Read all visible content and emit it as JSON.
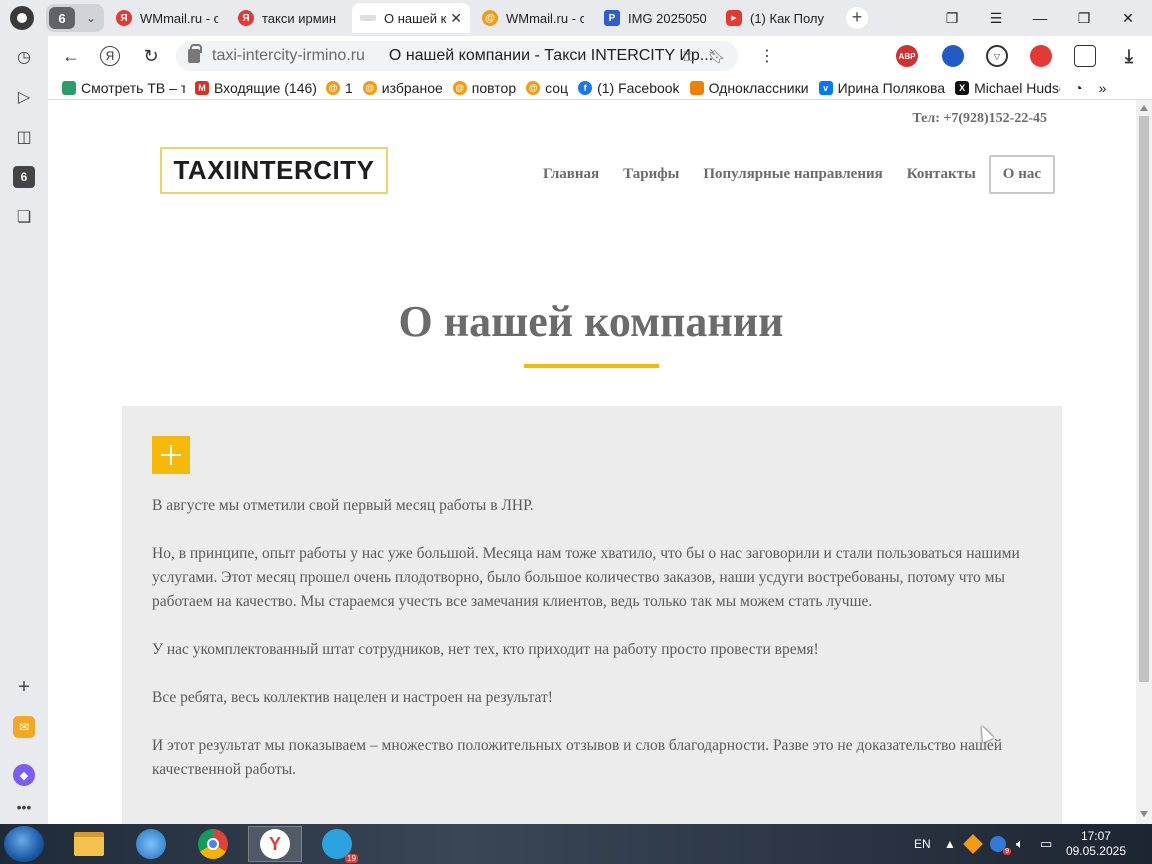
{
  "browser": {
    "tab_group_count": "6",
    "tabs": [
      {
        "title": "WMmail.ru - с",
        "favicon": "yandex-icon",
        "color": "#e53935",
        "letter": "Я"
      },
      {
        "title": "такси ирмин",
        "favicon": "yandex-icon",
        "color": "#e53935",
        "letter": "Я"
      },
      {
        "title": "О нашей к",
        "favicon": "taxi-site-icon",
        "color": "#cccccc",
        "letter": "",
        "active": true
      },
      {
        "title": "WMmail.ru - с",
        "favicon": "wmmail-icon",
        "color": "#f39c12",
        "letter": "@"
      },
      {
        "title": "IMG 2025050",
        "favicon": "image-icon",
        "color": "#2f5bd3",
        "letter": "P"
      },
      {
        "title": "(1) Как Полу",
        "favicon": "youtube-icon",
        "color": "#e53935",
        "letter": "▶"
      }
    ],
    "url": "taxi-intercity-irmino.ru",
    "page_title": "О нашей компании - Такси INTERCITY Ир...",
    "sidebar_badge": "6",
    "bookmarks": [
      {
        "label": "Смотреть ТВ – те",
        "icon": "tv-icon",
        "color": "#2e9b6d"
      },
      {
        "label": "Входящие (146) -",
        "icon": "gmail-icon",
        "color": "#d93025"
      },
      {
        "label": "1",
        "icon": "wmmail-icon",
        "color": "#f39c12"
      },
      {
        "label": "избраное",
        "icon": "wmmail-icon",
        "color": "#f39c12"
      },
      {
        "label": "повтор",
        "icon": "wmmail-icon",
        "color": "#f39c12"
      },
      {
        "label": "соц",
        "icon": "wmmail-icon",
        "color": "#f39c12"
      },
      {
        "label": "(1) Facebook",
        "icon": "facebook-icon",
        "color": "#1877f2"
      },
      {
        "label": "Одноклассники",
        "icon": "ok-icon",
        "color": "#ee8208"
      },
      {
        "label": "Ирина Полякова",
        "icon": "vk-icon",
        "color": "#0077ff"
      },
      {
        "label": "Michael Hudso",
        "icon": "x-icon",
        "color": "#111111"
      }
    ],
    "extensions": {
      "abp": "ABP"
    }
  },
  "site": {
    "phone": "Тел: +7(928)152-22-45",
    "logo": "TAXIINTERCITY",
    "nav": [
      "Главная",
      "Тарифы",
      "Популярные направления",
      "Контакты",
      "О нас"
    ],
    "heading": "О нашей компании",
    "paragraphs": [
      "В августе мы отметили свой первый месяц работы в ЛНР.",
      "Но, в принципе, опыт работы у нас уже большой. Месяца нам тоже хватило, что бы о нас заговорили и стали пользоваться нашими услугами. Этот месяц прошел очень плодотворно, было большое количество заказов, наши усдуги востребованы, потому что мы работаем на качество. Мы стараемся учесть все замечания клиентов, ведь только так мы можем стать лучше.",
      "У нас укомплектованный штат сотрудников, нет тех, кто приходит на работу просто провести время!",
      "Все ребята, весь коллектив нацелен и настроен на результат!",
      "И этот результат мы показываем – множество положительных отзывов и слов благодарности. Разве это не доказательство нашей качественной работы."
    ]
  },
  "taskbar": {
    "language": "EN",
    "telegram_badge": "19",
    "tray_badge": "9",
    "time": "17:07",
    "date": "09.05.2025"
  }
}
